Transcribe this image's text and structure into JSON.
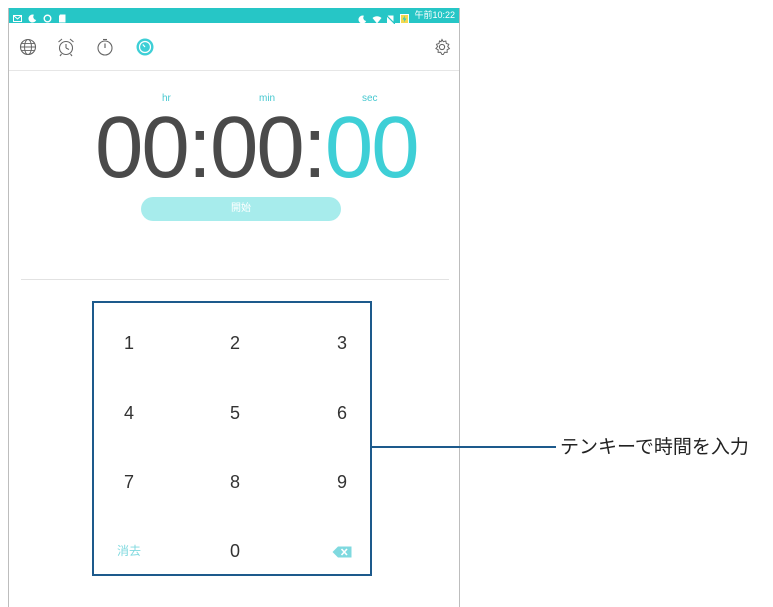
{
  "status_bar": {
    "time": "午前10:22",
    "color": "#26c6c6",
    "left_icons": [
      "message-icon",
      "moon-icon",
      "sync-icon",
      "sd-card-icon"
    ],
    "right_icons": [
      "moon-icon",
      "wifi-icon",
      "no-sim-icon",
      "battery-charging-icon"
    ]
  },
  "tabs": [
    {
      "name": "world-clock",
      "icon": "globe-icon"
    },
    {
      "name": "alarm",
      "icon": "alarm-icon"
    },
    {
      "name": "stopwatch",
      "icon": "stopwatch-icon"
    },
    {
      "name": "timer",
      "icon": "timer-icon",
      "active": true
    }
  ],
  "settings_icon": "gear-icon",
  "timer": {
    "units": {
      "hr": "hr",
      "min": "min",
      "sec": "sec"
    },
    "display": {
      "hours": "00",
      "minutes": "00",
      "seconds": "00",
      "sep1": ":",
      "sep2": ":"
    },
    "start_label": "開始",
    "accent": "#3ecfd6"
  },
  "keypad": {
    "keys": [
      "1",
      "2",
      "3",
      "4",
      "5",
      "6",
      "7",
      "8",
      "9"
    ],
    "clear_label": "消去",
    "zero": "0",
    "backspace_icon": "backspace-icon"
  },
  "callout": {
    "text": "テンキーで時間を入力",
    "color": "#1d5a8c"
  }
}
